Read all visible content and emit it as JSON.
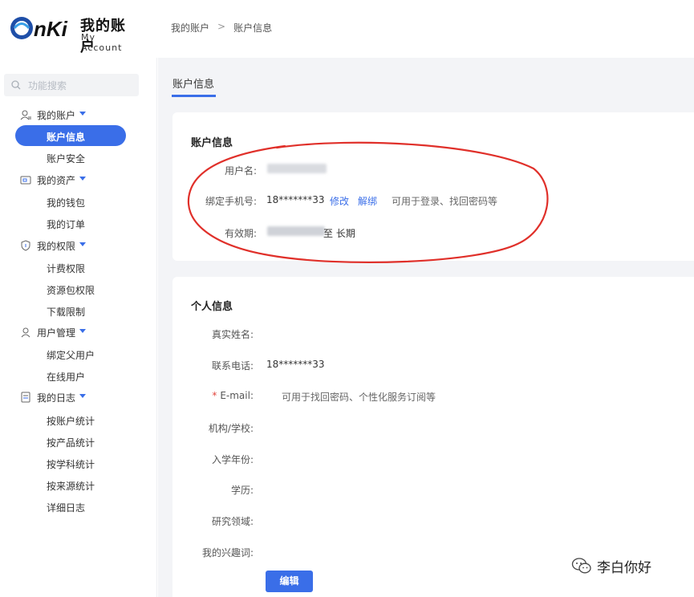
{
  "header": {
    "logo_mark": "CNKI",
    "logo_title": "我的账户",
    "logo_subtitle": "My Account",
    "breadcrumb": [
      "我的账户",
      "账户信息"
    ],
    "breadcrumb_sep": ">"
  },
  "sidebar": {
    "search_placeholder": "功能搜索",
    "groups": [
      {
        "label": "我的账户",
        "icon": "user-icon",
        "items": [
          {
            "label": "账户信息",
            "active": true
          },
          {
            "label": "账户安全"
          }
        ]
      },
      {
        "label": "我的资产",
        "icon": "wallet-icon",
        "items": [
          {
            "label": "我的钱包"
          },
          {
            "label": "我的订单"
          }
        ]
      },
      {
        "label": "我的权限",
        "icon": "shield-icon",
        "items": [
          {
            "label": "计费权限"
          },
          {
            "label": "资源包权限"
          },
          {
            "label": "下载限制"
          }
        ]
      },
      {
        "label": "用户管理",
        "icon": "user-manage-icon",
        "items": [
          {
            "label": "绑定父用户"
          },
          {
            "label": "在线用户"
          }
        ]
      },
      {
        "label": "我的日志",
        "icon": "log-icon",
        "items": [
          {
            "label": "按账户统计"
          },
          {
            "label": "按产品统计"
          },
          {
            "label": "按学科统计"
          },
          {
            "label": "按来源统计"
          },
          {
            "label": "详细日志"
          }
        ]
      }
    ]
  },
  "main": {
    "tab": "账户信息",
    "account_card": {
      "title": "账户信息",
      "username_label": "用户名:",
      "phone_label": "绑定手机号:",
      "phone_value": "18*******33",
      "modify_link": "修改",
      "unbind_link": "解绑",
      "phone_hint": "可用于登录、找回密码等",
      "validity_label": "有效期:",
      "validity_value": "至 长期"
    },
    "personal_card": {
      "title": "个人信息",
      "real_name_label": "真实姓名:",
      "phone_label": "联系电话:",
      "phone_value": "18*******33",
      "email_required": "*",
      "email_label": "E-mail:",
      "email_hint": "可用于找回密码、个性化服务订阅等",
      "org_label": "机构/学校:",
      "enroll_label": "入学年份:",
      "education_label": "学历:",
      "research_label": "研究领域:",
      "interest_label": "我的兴趣词:",
      "edit_button": "编辑"
    }
  },
  "watermark": {
    "text": "李白你好"
  },
  "colors": {
    "accent": "#3a6ee8",
    "annotation": "#e0302a",
    "page_bg": "#f3f4f7"
  }
}
